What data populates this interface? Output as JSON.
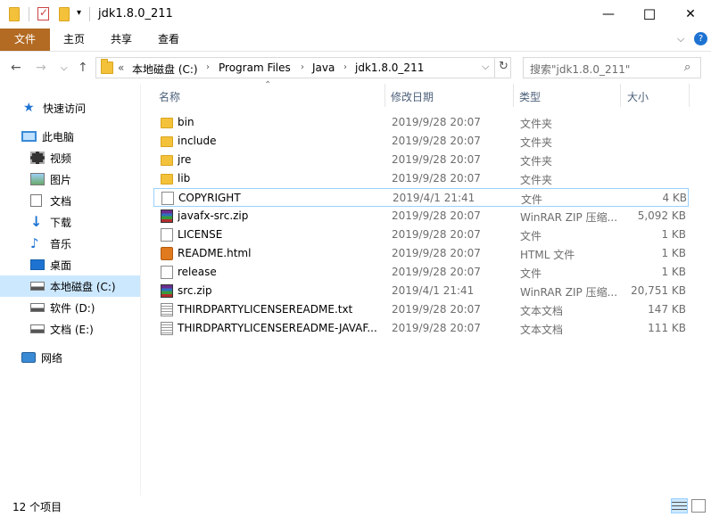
{
  "window": {
    "title": "jdk1.8.0_211",
    "min_glyph": "—",
    "max_glyph": "☐",
    "close_glyph": "✕"
  },
  "ribbon": {
    "tabs": [
      "文件",
      "主页",
      "共享",
      "查看"
    ],
    "help_glyph": "?"
  },
  "address": {
    "overflow": "«",
    "segments": [
      "本地磁盘 (C:)",
      "Program Files",
      "Java",
      "jdk1.8.0_211"
    ],
    "search_placeholder": "搜索\"jdk1.8.0_211\""
  },
  "nav": {
    "items": [
      {
        "label": "快速访问",
        "icon": "star-icon"
      },
      {
        "label": "此电脑",
        "icon": "pc-icon"
      },
      {
        "label": "视频",
        "icon": "video-icon"
      },
      {
        "label": "图片",
        "icon": "picture-icon"
      },
      {
        "label": "文档",
        "icon": "document-icon"
      },
      {
        "label": "下载",
        "icon": "download-icon"
      },
      {
        "label": "音乐",
        "icon": "music-icon"
      },
      {
        "label": "桌面",
        "icon": "desktop-icon"
      },
      {
        "label": "本地磁盘 (C:)",
        "icon": "drive-icon"
      },
      {
        "label": "软件 (D:)",
        "icon": "drive-icon"
      },
      {
        "label": "文档 (E:)",
        "icon": "drive-icon"
      },
      {
        "label": "网络",
        "icon": "network-icon"
      }
    ]
  },
  "columns": {
    "name": "名称",
    "date": "修改日期",
    "type": "类型",
    "size": "大小"
  },
  "files": [
    {
      "name": "bin",
      "date": "2019/9/28 20:07",
      "type": "文件夹",
      "size": "",
      "icon": "folder"
    },
    {
      "name": "include",
      "date": "2019/9/28 20:07",
      "type": "文件夹",
      "size": "",
      "icon": "folder"
    },
    {
      "name": "jre",
      "date": "2019/9/28 20:07",
      "type": "文件夹",
      "size": "",
      "icon": "folder"
    },
    {
      "name": "lib",
      "date": "2019/9/28 20:07",
      "type": "文件夹",
      "size": "",
      "icon": "folder"
    },
    {
      "name": "COPYRIGHT",
      "date": "2019/4/1 21:41",
      "type": "文件",
      "size": "4 KB",
      "icon": "file"
    },
    {
      "name": "javafx-src.zip",
      "date": "2019/9/28 20:07",
      "type": "WinRAR ZIP 压缩...",
      "size": "5,092 KB",
      "icon": "rar"
    },
    {
      "name": "LICENSE",
      "date": "2019/9/28 20:07",
      "type": "文件",
      "size": "1 KB",
      "icon": "file"
    },
    {
      "name": "README.html",
      "date": "2019/9/28 20:07",
      "type": "HTML 文件",
      "size": "1 KB",
      "icon": "html"
    },
    {
      "name": "release",
      "date": "2019/9/28 20:07",
      "type": "文件",
      "size": "1 KB",
      "icon": "file"
    },
    {
      "name": "src.zip",
      "date": "2019/4/1 21:41",
      "type": "WinRAR ZIP 压缩...",
      "size": "20,751 KB",
      "icon": "rar"
    },
    {
      "name": "THIRDPARTYLICENSEREADME.txt",
      "date": "2019/9/28 20:07",
      "type": "文本文档",
      "size": "147 KB",
      "icon": "txt"
    },
    {
      "name": "THIRDPARTYLICENSEREADME-JAVAF...",
      "date": "2019/9/28 20:07",
      "type": "文本文档",
      "size": "111 KB",
      "icon": "txt"
    }
  ],
  "status": {
    "count": "12 个项目"
  }
}
